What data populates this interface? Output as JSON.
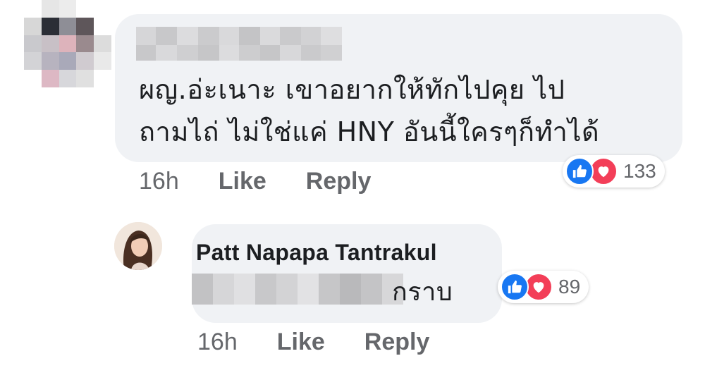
{
  "comment1": {
    "line1": "ผญ.อ่ะเนาะ เขาอยากให้ทักไปคุย ไป",
    "line2": "ถามไถ่ ไม่ใช่แค่ HNY อันนี้ใครๆก็ทำได้",
    "time": "16h",
    "like_label": "Like",
    "reply_label": "Reply",
    "reaction_icons": [
      "like-icon",
      "love-icon"
    ],
    "reaction_count": "133"
  },
  "comment2": {
    "author": "Patt Napapa Tantrakul",
    "text_suffix": "กราบ",
    "time": "16h",
    "like_label": "Like",
    "reply_label": "Reply",
    "reaction_icons": [
      "like-icon",
      "love-icon"
    ],
    "reaction_count": "89"
  },
  "colors": {
    "bubble": "#f0f2f5",
    "meta_text": "#65676b",
    "like_blue": "#1877f2",
    "love_red": "#f33e58"
  }
}
